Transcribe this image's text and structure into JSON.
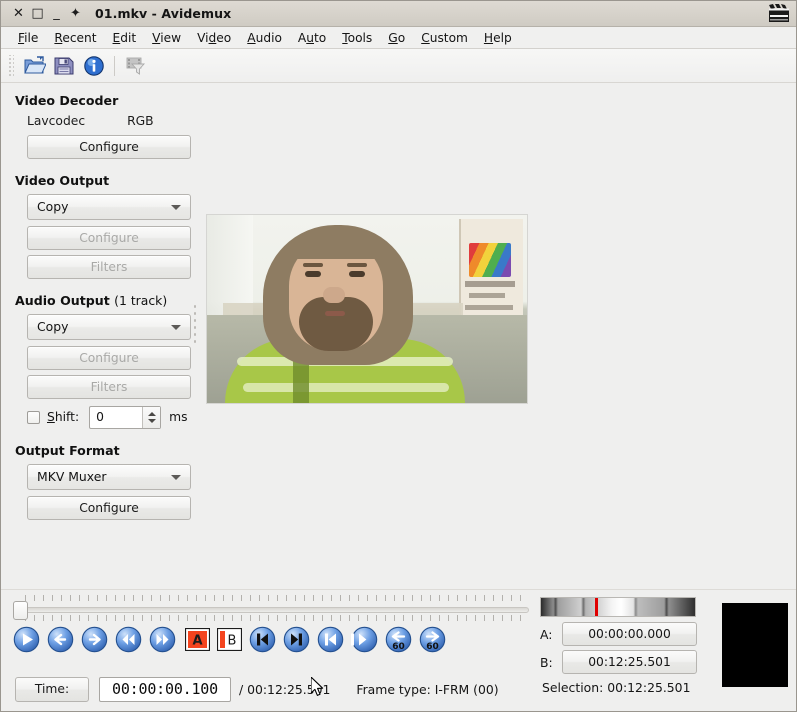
{
  "window": {
    "title": "01.mkv - Avidemux",
    "controls": [
      {
        "name": "close",
        "glyph": "✕"
      },
      {
        "name": "maximize",
        "glyph": "□"
      },
      {
        "name": "minimize",
        "glyph": "_"
      },
      {
        "name": "shade",
        "glyph": "✦"
      }
    ],
    "app_icon": "clapperboard-icon"
  },
  "menubar": {
    "items": [
      {
        "label": "File",
        "mnemonic": "F"
      },
      {
        "label": "Recent",
        "mnemonic": "R"
      },
      {
        "label": "Edit",
        "mnemonic": "E"
      },
      {
        "label": "View",
        "mnemonic": "V"
      },
      {
        "label": "Video",
        "mnemonic": "d"
      },
      {
        "label": "Audio",
        "mnemonic": "A"
      },
      {
        "label": "Auto",
        "mnemonic": "u"
      },
      {
        "label": "Tools",
        "mnemonic": "T"
      },
      {
        "label": "Go",
        "mnemonic": "G"
      },
      {
        "label": "Custom",
        "mnemonic": "C"
      },
      {
        "label": "Help",
        "mnemonic": "H"
      }
    ]
  },
  "toolbar": {
    "buttons": [
      {
        "name": "open-file",
        "icon": "open-folder-icon",
        "enabled": true
      },
      {
        "name": "save-file",
        "icon": "floppy-save-icon",
        "enabled": true
      },
      {
        "name": "file-info",
        "icon": "info-circle-icon",
        "enabled": true
      },
      {
        "name": "video-filters",
        "icon": "filmstrip-filter-icon",
        "enabled": false
      }
    ]
  },
  "video_decoder": {
    "title": "Video Decoder",
    "codec": "Lavcodec",
    "colorspace": "RGB",
    "configure_label": "Configure"
  },
  "video_output": {
    "title": "Video Output",
    "selected": "Copy",
    "configure_label": "Configure",
    "filters_label": "Filters"
  },
  "audio_output": {
    "title": "Audio Output",
    "track_info": "(1 track)",
    "selected": "Copy",
    "configure_label": "Configure",
    "filters_label": "Filters",
    "shift_label": "Shift:",
    "shift_value": "0",
    "shift_unit": "ms",
    "shift_enabled": false
  },
  "output_format": {
    "title": "Output Format",
    "selected": "MKV Muxer",
    "configure_label": "Configure"
  },
  "transport": {
    "buttons": [
      {
        "name": "play-button",
        "icon": "play-icon"
      },
      {
        "name": "previous-frame-button",
        "icon": "arrow-left-icon"
      },
      {
        "name": "next-frame-button",
        "icon": "arrow-right-icon"
      },
      {
        "name": "rewind-button",
        "icon": "double-arrow-left-icon"
      },
      {
        "name": "fast-forward-button",
        "icon": "double-arrow-right-icon"
      },
      {
        "name": "set-marker-a-button",
        "icon": "marker-a-icon",
        "label": "A"
      },
      {
        "name": "set-marker-b-button",
        "icon": "marker-b-icon",
        "label": "B"
      },
      {
        "name": "go-to-marker-a-button",
        "icon": "skip-start-icon"
      },
      {
        "name": "go-to-marker-b-button",
        "icon": "skip-end-icon"
      },
      {
        "name": "previous-keyframe-button",
        "icon": "prev-keyframe-icon"
      },
      {
        "name": "next-keyframe-button",
        "icon": "next-keyframe-icon"
      },
      {
        "name": "back-60-seconds-button",
        "icon": "back-60-icon",
        "label": "60"
      },
      {
        "name": "forward-60-seconds-button",
        "icon": "forward-60-icon",
        "label": "60"
      }
    ]
  },
  "status": {
    "time_label": "Time:",
    "current_time": "00:00:00.100",
    "total_time": "/ 00:12:25.501",
    "frame_type": "Frame type:  I-FRM (00)"
  },
  "markers": {
    "a_label": "A:",
    "a_time": "00:00:00.000",
    "b_label": "B:",
    "b_time": "00:12:25.501",
    "selection": "Selection: 00:12:25.501"
  },
  "colors": {
    "accent_blue": "#4a7fd4",
    "marker_red": "#e00000",
    "window_bg": "#efefee",
    "titlebar_bg": "#d6d2ca"
  }
}
